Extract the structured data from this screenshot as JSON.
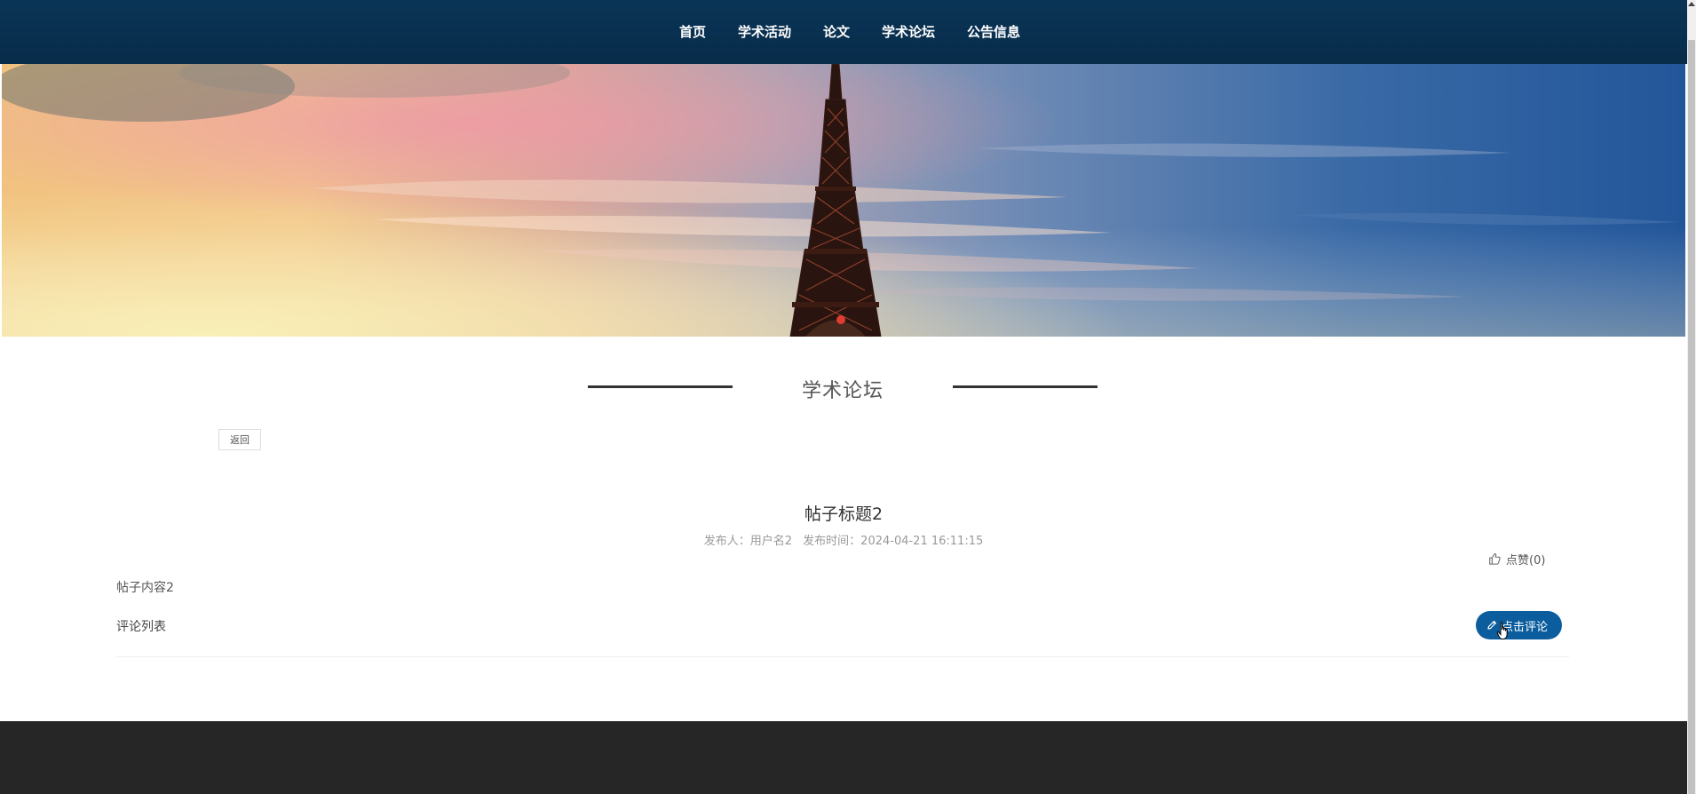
{
  "nav": {
    "items": [
      {
        "label": "首页"
      },
      {
        "label": "学术活动"
      },
      {
        "label": "论文"
      },
      {
        "label": "学术论坛"
      },
      {
        "label": "公告信息"
      }
    ]
  },
  "banner": {
    "icon": "eiffel-tower-sunset-image",
    "carousel_indicator_color": "#e03c31"
  },
  "section": {
    "title": "学术论坛"
  },
  "back_button": {
    "label": "返回"
  },
  "post": {
    "title": "帖子标题2",
    "author_text": "发布人：用户名2",
    "time_text": "发布时间：2024-04-21 16:11:15",
    "content": "帖子内容2"
  },
  "like": {
    "label": "点赞(0)",
    "icon": "thumbs-up-icon"
  },
  "comments": {
    "list_label": "评论列表",
    "button_label": "点击评论",
    "button_icon": "pencil-icon"
  },
  "colors": {
    "nav_bg": "#0a3456",
    "accent_button": "#0b5d9e",
    "footer_bg": "#262626"
  }
}
